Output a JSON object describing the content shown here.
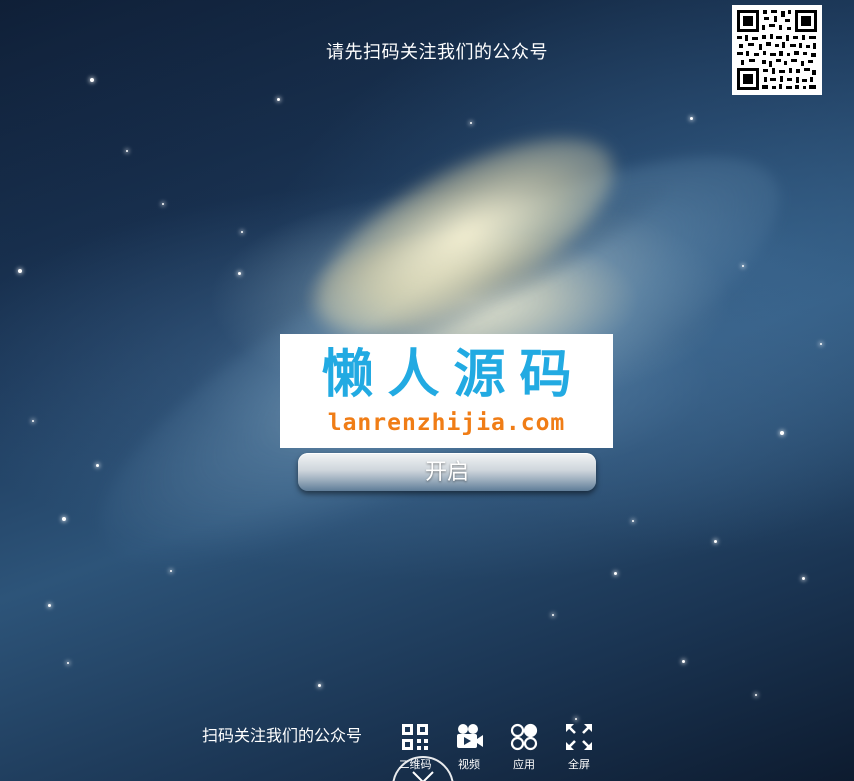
{
  "top_prompt": "请先扫码关注我们的公众号",
  "logo": {
    "title": "懒人源码",
    "url": "lanrenzhijia.com"
  },
  "start_button": {
    "label": "开启"
  },
  "bottom_bar": {
    "prompt": "扫码关注我们的公众号",
    "items": [
      {
        "label": "二维码",
        "icon": "qr-code-icon"
      },
      {
        "label": "视频",
        "icon": "video-camera-icon"
      },
      {
        "label": "应用",
        "icon": "apps-icon"
      },
      {
        "label": "全屏",
        "icon": "fullscreen-icon"
      }
    ]
  },
  "colors": {
    "logo_title": "#22aae2",
    "logo_url": "#f07d16",
    "text": "#ffffff"
  }
}
